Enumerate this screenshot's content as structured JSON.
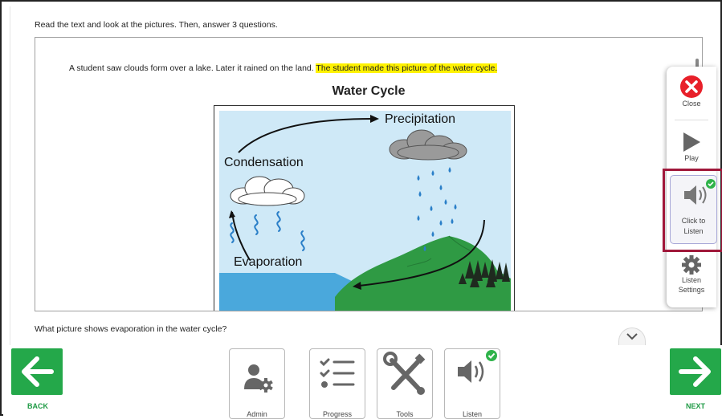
{
  "instructions": "Read the text and look at the pictures. Then, answer 3 questions.",
  "passage": {
    "text_plain": "A student saw clouds form over a lake. Later it rained on the land. ",
    "text_highlighted": "The student made this picture of the water cycle."
  },
  "diagram": {
    "title": "Water Cycle",
    "labels": {
      "precipitation": "Precipitation",
      "condensation": "Condensation",
      "evaporation": "Evaporation"
    }
  },
  "question": "What picture shows evaporation in the water cycle?",
  "side_panel": {
    "close": "Close",
    "play": "Play",
    "click_to_listen_1": "Click to",
    "click_to_listen_2": "Listen",
    "settings_1": "Listen",
    "settings_2": "Settings"
  },
  "toolbar": {
    "back": "BACK",
    "next": "NEXT",
    "admin": "Admin",
    "progress": "Progress",
    "tools": "Tools",
    "listen": "Listen"
  },
  "colors": {
    "accent_green": "#24a84a",
    "close_red": "#e8202a",
    "highlight_frame": "#a0183a",
    "text_highlight": "#fff200",
    "sky": "#cfe9f7",
    "water": "#4aa8dc",
    "land": "#2f9a44"
  },
  "icons": [
    "arrow-left-icon",
    "arrow-right-icon",
    "admin-user-gear-icon",
    "progress-checklist-icon",
    "tools-wrench-screwdriver-icon",
    "speaker-icon",
    "check-badge-icon",
    "close-x-icon",
    "play-triangle-icon",
    "gear-icon",
    "chevron-down-icon"
  ]
}
